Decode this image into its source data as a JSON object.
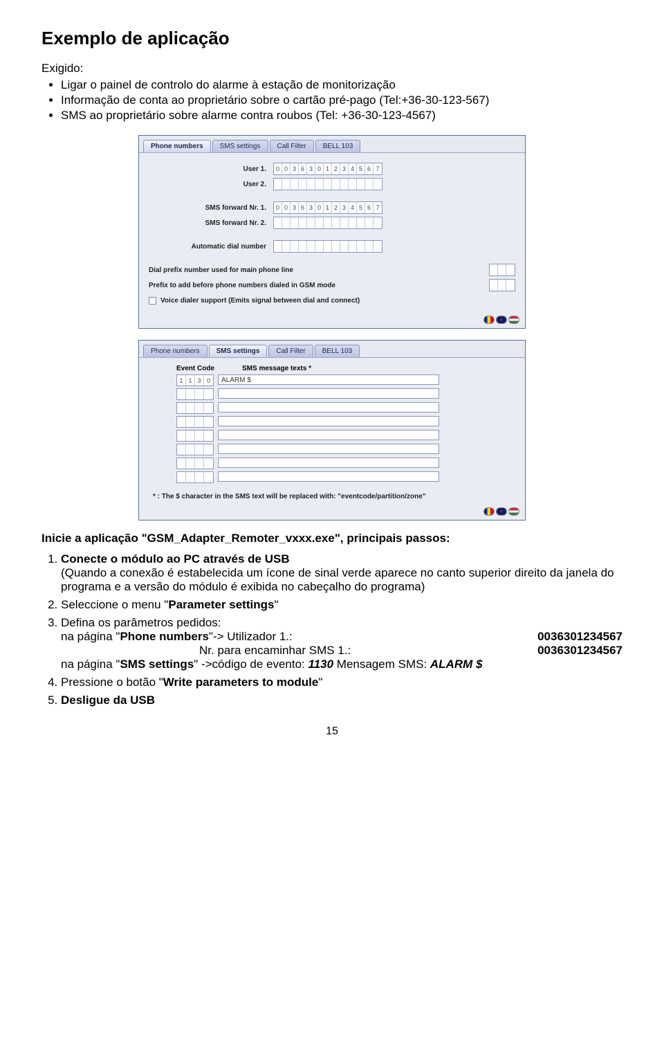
{
  "title": "Exemplo de aplicação",
  "subhead": "Exigido:",
  "bullets": [
    "Ligar o painel de controlo do alarme à estação de monitorização",
    "Informação de conta ao proprietário sobre o cartão pré-pago (Tel:+36-30-123-567)",
    "SMS ao proprietário sobre alarme contra roubos (Tel: +36-30-123-4567)"
  ],
  "tabs": [
    "Phone numbers",
    "SMS settings",
    "Call Filter",
    "BELL 103"
  ],
  "phone": {
    "user1_label": "User 1.",
    "user2_label": "User 2.",
    "user1_digits": [
      "0",
      "0",
      "3",
      "6",
      "3",
      "0",
      "1",
      "2",
      "3",
      "4",
      "5",
      "6",
      "7"
    ],
    "empty13": [
      "",
      "",
      "",
      "",
      "",
      "",
      "",
      "",
      "",
      "",
      "",
      "",
      ""
    ],
    "smsfw1_label": "SMS forward Nr. 1.",
    "smsfw2_label": "SMS forward Nr. 2.",
    "smsfw1_digits": [
      "0",
      "0",
      "3",
      "6",
      "3",
      "0",
      "1",
      "2",
      "3",
      "4",
      "5",
      "6",
      "7"
    ],
    "auto_label": "Automatic dial number",
    "dial_prefix_label": "Dial prefix number used for main phone line",
    "gsm_prefix_label": "Prefix to add before phone numbers dialed in GSM mode",
    "empty3": [
      "",
      "",
      ""
    ],
    "voice_label": "Voice dialer support (Emits signal between dial and connect)"
  },
  "sms": {
    "header_event": "Event Code",
    "header_msg": "SMS message texts *",
    "rows": [
      {
        "code": [
          "1",
          "1",
          "3",
          "0"
        ],
        "text": "ALARM $"
      },
      {
        "code": [
          "",
          "",
          "",
          ""
        ],
        "text": ""
      },
      {
        "code": [
          "",
          "",
          "",
          ""
        ],
        "text": ""
      },
      {
        "code": [
          "",
          "",
          "",
          ""
        ],
        "text": ""
      },
      {
        "code": [
          "",
          "",
          "",
          ""
        ],
        "text": ""
      },
      {
        "code": [
          "",
          "",
          "",
          ""
        ],
        "text": ""
      },
      {
        "code": [
          "",
          "",
          "",
          ""
        ],
        "text": ""
      },
      {
        "code": [
          "",
          "",
          "",
          ""
        ],
        "text": ""
      }
    ],
    "footnote": "* : The $ character in the SMS text will be replaced with: \"eventcode/partition/zone\""
  },
  "instr": {
    "heading": "Inicie a aplicação \"GSM_Adapter_Remoter_vxxx.exe\", principais passos:",
    "s1_lead": "Conecte o módulo ao PC através de USB",
    "s1_body": "(Quando a conexão é estabelecida um ícone de sinal verde aparece no canto superior direito da janela do programa e a versão do módulo é exibida no cabeçalho do programa)",
    "s2_a": "Seleccione o menu \"",
    "s2_b": "Parameter settings",
    "s2_c": "\"",
    "s3_a": "Defina os parâmetros pedidos:",
    "s3_line1_a": "na página \"",
    "s3_line1_b": "Phone numbers",
    "s3_line1_c": "\"-> Utilizador 1.:",
    "s3_line1_v": "0036301234567",
    "s3_line2_a": "Nr. para encaminhar SMS  1.:",
    "s3_line2_v": "0036301234567",
    "s3_line3_a": "na página \"",
    "s3_line3_b": "SMS settings",
    "s3_line3_c": "\"   ->código de evento: ",
    "s3_line3_d": "1130",
    "s3_line3_e": " Mensagem SMS: ",
    "s3_line3_f": "ALARM $",
    "s4_a": "Pressione o botão \"",
    "s4_b": "Write parameters to module",
    "s4_c": "\"",
    "s5": "Desligue da USB"
  },
  "page_num": "15"
}
